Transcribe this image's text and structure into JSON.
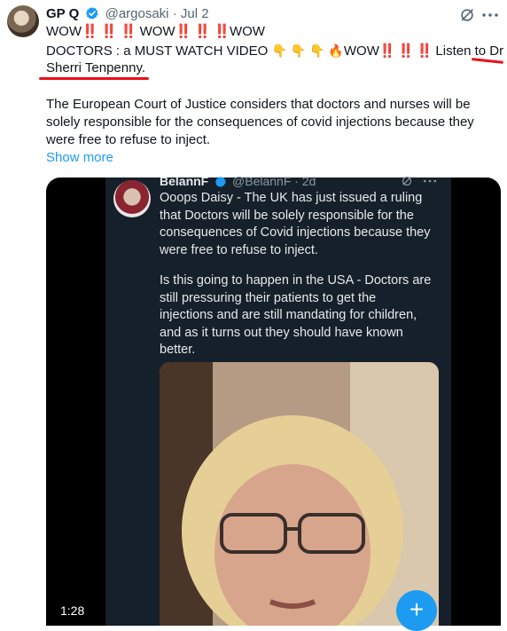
{
  "tweet": {
    "author_name": "GP Q",
    "handle": "@argosaki",
    "separator": "·",
    "date": "Jul 2",
    "line1": [
      "WOW",
      "‼️",
      "‼️",
      "‼️",
      "WOW",
      "‼️",
      "‼️",
      "‼️",
      "WOW"
    ],
    "line2_a": "DOCTORS : a MUST WATCH VIDEO ",
    "line2_emoji": "👇 👇 👇 🔥",
    "line2_b": "WOW",
    "line2_c": "Listen to Dr",
    "line3": "Sherri Tenpenny.",
    "paragraph": "The European Court of Justice considers that doctors and nurses will be solely responsible for the consequences of covid injections because they were free to refuse to inject.",
    "show_more": "Show more"
  },
  "quoted": {
    "name": "BelannF",
    "handle": "@BelannF",
    "separator": "·",
    "date": "2d",
    "paragraph1": [
      "Ooops Daisy - The UK has just issued a ruling",
      "that Doctors will be solely responsible for the",
      "consequences of Covid injections because they",
      "were free to refuse to inject."
    ],
    "paragraph2": [
      "Is this going to happen in the USA - Doctors are",
      "still pressuring their patients to get the",
      "injections and are still mandating for children,",
      "and as it turns out they should have known",
      "better."
    ]
  },
  "video": {
    "duration": "1:28",
    "plus_label": "+"
  },
  "colors": {
    "accent": "#1d9bf0",
    "annotation_red": "#e8101a",
    "dark_bg": "#15202b"
  }
}
